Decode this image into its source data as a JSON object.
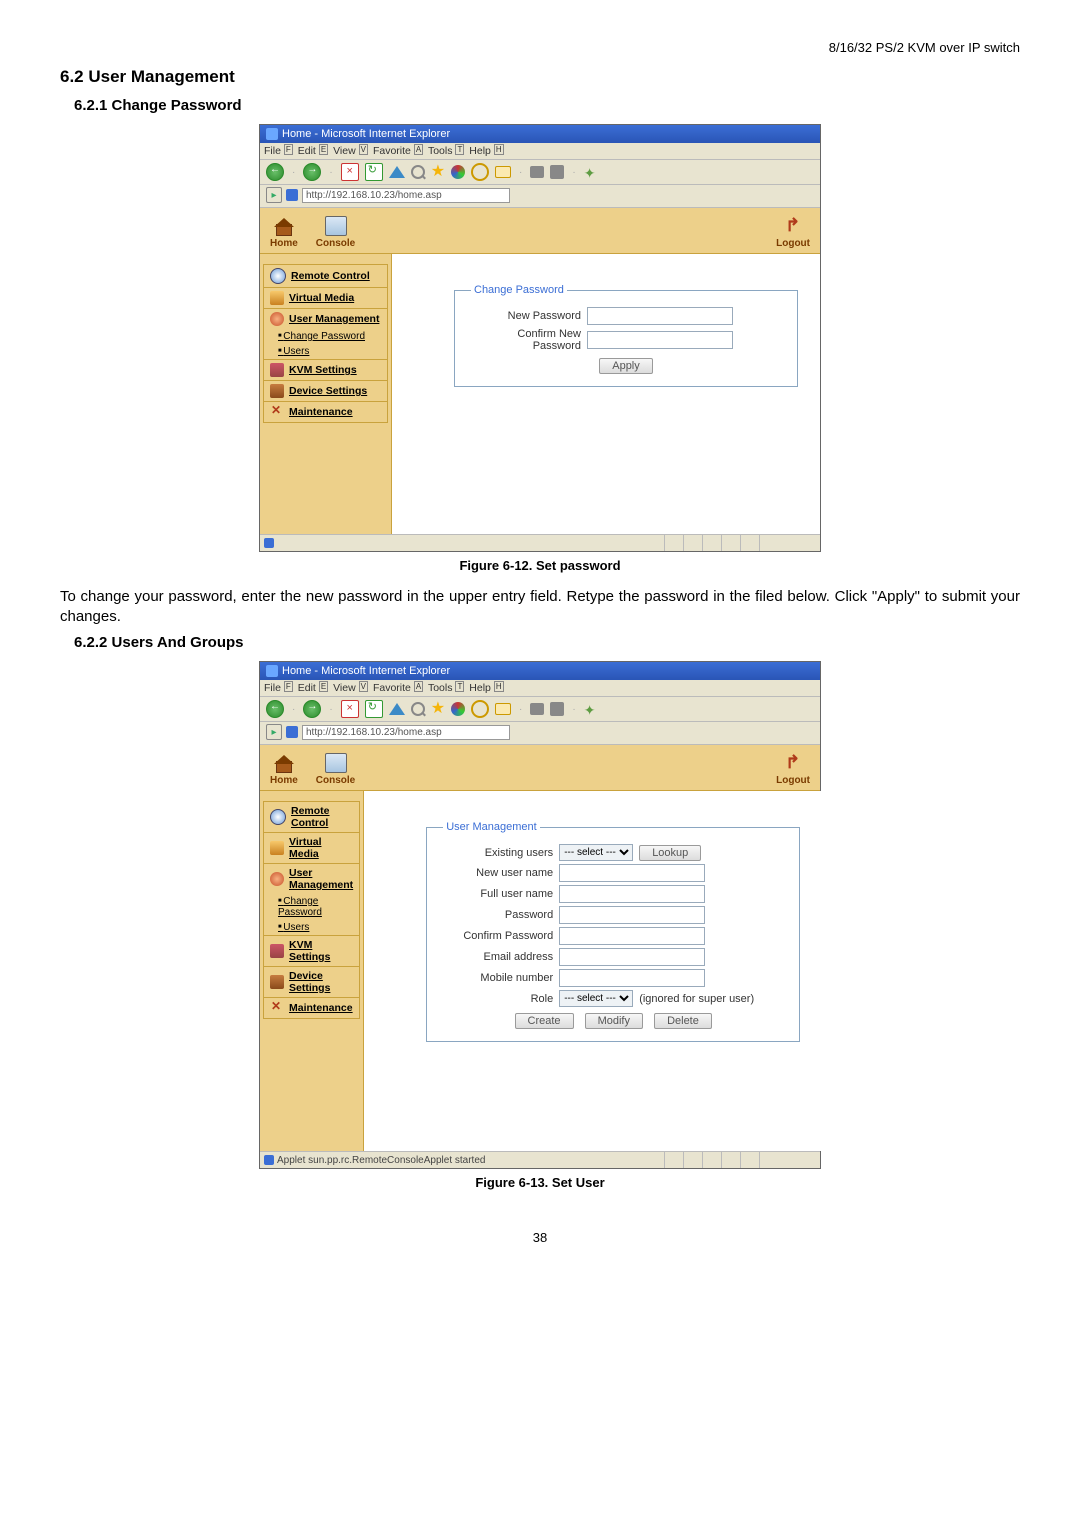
{
  "page_header": "8/16/32 PS/2 KVM over IP switch",
  "headings": {
    "h2": "6.2 User Management",
    "h3a": "6.2.1   Change Password",
    "h3b": "6.2.2   Users And Groups"
  },
  "caption1": "Figure 6-12. Set password",
  "paragraph1": "To change your password, enter the new password in the upper entry field. Retype the password in the filed below. Click \"Apply\" to submit your changes.",
  "caption2": "Figure 6-13. Set User",
  "page_num": "38",
  "browser": {
    "title": "Home - Microsoft Internet Explorer",
    "menu": {
      "file": "File",
      "file_a": "F",
      "edit": "Edit",
      "edit_a": "E",
      "view": "View",
      "view_a": "V",
      "fav": "Favorite",
      "fav_a": "A",
      "tools": "Tools",
      "tools_a": "T",
      "help": "Help",
      "help_a": "H"
    },
    "url": "http://192.168.10.23/home.asp"
  },
  "topnav": {
    "home": "Home",
    "console": "Console",
    "logout": "Logout"
  },
  "sidebar": {
    "remote": "Remote Control",
    "vmedia": "Virtual Media",
    "umgmt": "User Management",
    "chpw": "Change Password",
    "users": "Users",
    "kvm": "KVM Settings",
    "device": "Device Settings",
    "maint": "Maintenance"
  },
  "panel1": {
    "legend": "Change Password",
    "row1": "New Password",
    "row2": "Confirm New Password",
    "apply": "Apply"
  },
  "panel2": {
    "legend": "User Management",
    "existing": "Existing users",
    "sel_opt": "--- select ---",
    "lookup": "Lookup",
    "new_user": "New user name",
    "full": "Full user name",
    "pw": "Password",
    "cpw": "Confirm Password",
    "email": "Email address",
    "mobile": "Mobile number",
    "role": "Role",
    "role_opt": "--- select ---",
    "role_note": "(ignored for super user)",
    "create": "Create",
    "modify": "Modify",
    "delete": "Delete"
  },
  "status2": "Applet sun.pp.rc.RemoteConsoleApplet started"
}
